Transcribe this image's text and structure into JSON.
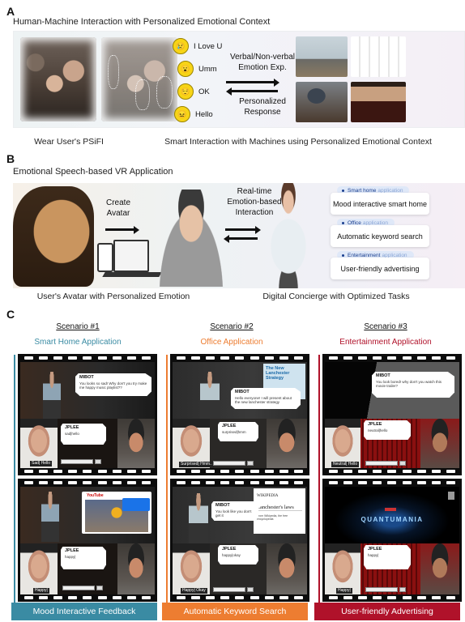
{
  "panel_a": {
    "letter": "A",
    "title": "Human-Machine Interaction with Personalized Emotional Context",
    "emotions": [
      {
        "icon": "crying-face-icon",
        "label": "I Love U",
        "glyph": "😢"
      },
      {
        "icon": "surprised-face-icon",
        "label": "Umm",
        "glyph": "😮"
      },
      {
        "icon": "relieved-face-icon",
        "label": "OK",
        "glyph": "😌"
      },
      {
        "icon": "confounded-face-icon",
        "label": "Hello",
        "glyph": "😖"
      }
    ],
    "arrow_top_label": "Verbal/Non-verbal Emotion Exp.",
    "arrow_top_line1": "Verbal/Non-verbal",
    "arrow_top_line2": "Emotion Exp.",
    "arrow_bottom_line1": "Personalized",
    "arrow_bottom_line2": "Response",
    "caption_left": "Wear User's PSiFI",
    "caption_right": "Smart Interaction with Machines using Personalized Emotional Context"
  },
  "panel_b": {
    "letter": "B",
    "title": "Emotional Speech-based VR Application",
    "create_line1": "Create",
    "create_line2": "Avatar",
    "realtime_line1": "Real-time",
    "realtime_line2": "Emotion-based",
    "realtime_line3": "Interaction",
    "apps": [
      {
        "tag": "Smart home",
        "tag_suffix": "application",
        "text": "Mood interactive smart home"
      },
      {
        "tag": "Office",
        "tag_suffix": "application",
        "text": "Automatic keyword search"
      },
      {
        "tag": "Entertainment",
        "tag_suffix": "application",
        "text": "User-friendly advertising"
      }
    ],
    "caption_left": "User's Avatar with Personalized Emotion",
    "caption_right": "Digital Concierge with Optimized Tasks"
  },
  "panel_c": {
    "letter": "C",
    "scenarios": [
      {
        "title": "Scenario #1",
        "app": "Smart Home Application",
        "color": "#3a8ba3",
        "footer": "Mood Interactive Feedback",
        "frames": [
          {
            "bot_name": "MIBOT",
            "bot_text": "You looks so sad! Why don't you try make me happy music playlist??",
            "user_name": "JPLEE",
            "user_text": "sad|hello",
            "user_label": "Sad| Hello"
          },
          {
            "bot_name": "",
            "bot_text": "",
            "user_name": "JPLEE",
            "user_text": "happy|",
            "user_label": "Happy|",
            "web_brand": "YouTube"
          }
        ]
      },
      {
        "title": "Scenario #2",
        "app": "Office Application",
        "color": "#ed7d31",
        "footer": "Automatic Keyword Search",
        "frames": [
          {
            "bot_name": "MIBOT",
            "bot_text": "Hello everyone! I will present about the new lanchester strategy",
            "user_name": "JPLEE",
            "user_text": "surprised|hmm",
            "user_label": "Surprised| Hmm..",
            "slide_title": "The New Lanchester Strategy"
          },
          {
            "bot_name": "MIBOT",
            "bot_text": "You look like you don't get it",
            "user_name": "JPLEE",
            "user_text": "happy|okay",
            "user_label": "Happy| Okay",
            "web_brand": "WIKIPEDIA",
            "web_title": "Lanchester's laws",
            "web_sub": "From Wikipedia, the free encyclopedia"
          }
        ]
      },
      {
        "title": "Scenario #3",
        "app": "Entertainment Application",
        "color": "#b0122a",
        "footer": "User-friendly Advertising",
        "frames": [
          {
            "bot_name": "MIBOT",
            "bot_text": "You look bored! why don't you watch this movie trailer?",
            "user_name": "JPLEE",
            "user_text": "neutral|hello",
            "user_label": "Neutral| Hello"
          },
          {
            "bot_name": "",
            "bot_text": "",
            "user_name": "JPLEE",
            "user_text": "happy|",
            "user_label": "Happy|",
            "movie_title": "QUANTUMANIA"
          }
        ]
      }
    ]
  }
}
